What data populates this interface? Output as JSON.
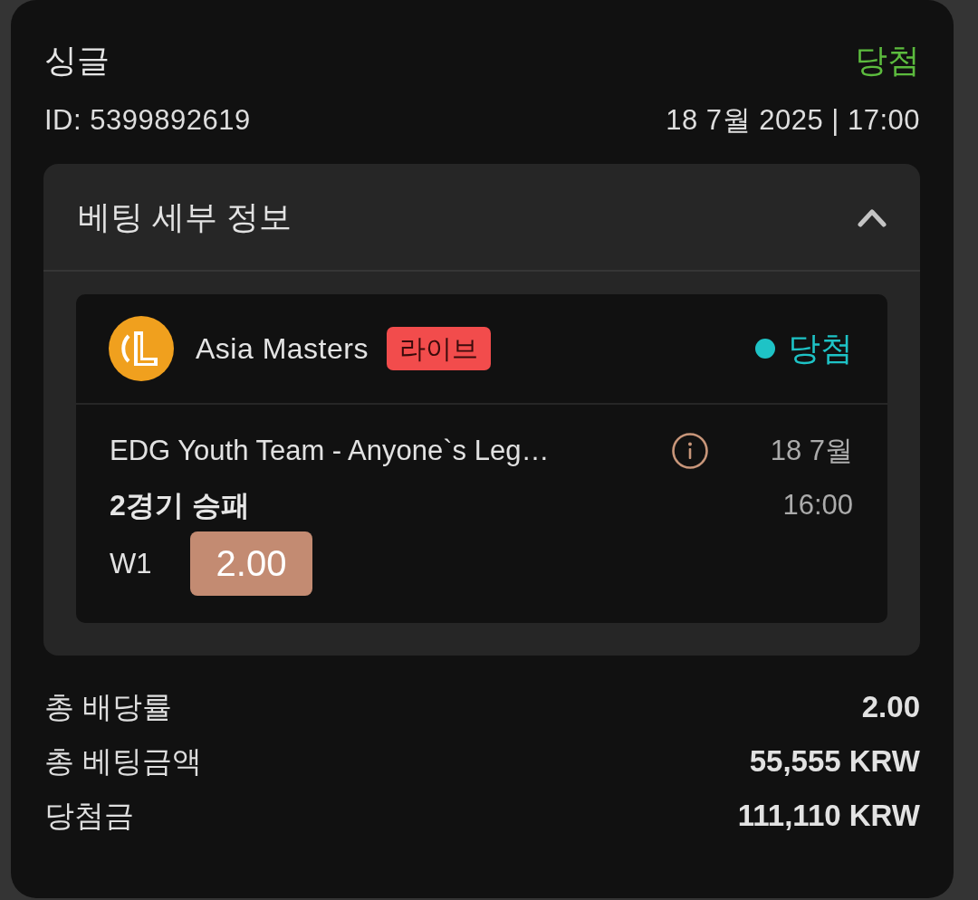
{
  "bet": {
    "type": "싱글",
    "status": {
      "label": "당첨",
      "kind": "won"
    },
    "id": "ID: 5399892619",
    "datetime": "18 7월 2025 | 17:00"
  },
  "details": {
    "title": "베팅 세부 정보",
    "expanded": true,
    "selections": [
      {
        "league": "Asia Masters",
        "badge": "라이브",
        "result": {
          "label": "당첨",
          "kind": "won"
        },
        "event": "EDG Youth Team - Anyone`s Leg…",
        "date": "18 7월",
        "time": "16:00",
        "market": "2경기 승패",
        "pick": "W1",
        "odds": "2.00"
      }
    ]
  },
  "summary": [
    {
      "label": "총 배당률",
      "value": "2.00"
    },
    {
      "label": "총 베팅금액",
      "value": "55,555 KRW"
    },
    {
      "label": "당첨금",
      "value": "111,110 KRW"
    }
  ]
}
